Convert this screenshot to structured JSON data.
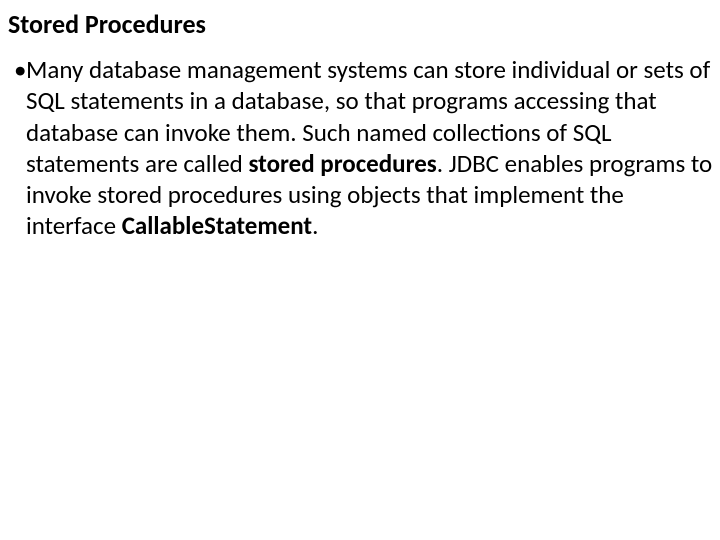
{
  "title": "Stored Procedures",
  "bullet": {
    "pre": "Many database management systems can store individual or sets of SQL statements in a database, so that programs accessing that database can invoke them. Such named collections of SQL statements are called ",
    "bold1": "stored procedures",
    "mid": ". JDBC enables programs to invoke stored procedures using objects that implement the interface ",
    "bold2": "CallableStatement",
    "post": "."
  }
}
